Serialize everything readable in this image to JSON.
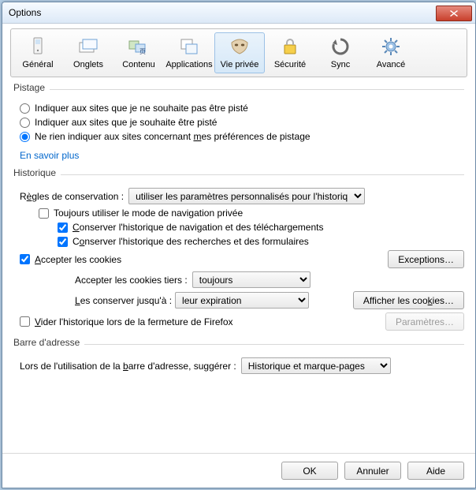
{
  "window": {
    "title": "Options"
  },
  "toolbar": {
    "items": [
      {
        "label": "Général"
      },
      {
        "label": "Onglets"
      },
      {
        "label": "Contenu"
      },
      {
        "label": "Applications"
      },
      {
        "label": "Vie privée"
      },
      {
        "label": "Sécurité"
      },
      {
        "label": "Sync"
      },
      {
        "label": "Avancé"
      }
    ],
    "selected_index": 4
  },
  "pistage": {
    "title": "Pistage",
    "r1": "Indiquer aux sites que je ne souhaite pas être pisté",
    "r2": "Indiquer aux sites que je souhaite être pisté",
    "r3_pre": "Ne rien indiquer aux sites concernant ",
    "r3_u": "m",
    "r3_post": "es préférences de pistage",
    "link": "En savoir plus"
  },
  "historique": {
    "title": "Historique",
    "rules_lbl_pre": "R",
    "rules_lbl_u": "è",
    "rules_lbl_post": "gles de conservation :",
    "rules_value": "utiliser les paramètres personnalisés pour l'historique",
    "c_private": "Toujours utiliser le mode de navigation privée",
    "c_nav_u": "C",
    "c_nav_post": "onserver l'historique de navigation et des téléchargements",
    "c_rech_pre": "C",
    "c_rech_u": "o",
    "c_rech_post": "nserver l'historique des recherches et des formulaires",
    "c_cookies_u": "A",
    "c_cookies_post": "ccepter les cookies",
    "exceptions": "Exceptions…",
    "tiers_label": "Accepter les cookies tiers :",
    "tiers_value": "toujours",
    "conserver_lbl_u": "L",
    "conserver_lbl_post": "es conserver jusqu'à :",
    "conserver_value": "leur expiration",
    "show_cookies_pre": "Afficher les coo",
    "show_cookies_u": "k",
    "show_cookies_post": "ies…",
    "c_vider_u": "V",
    "c_vider_post": "ider l'historique lors de la fermeture de Firefox",
    "parametres": "Paramètres…"
  },
  "barre": {
    "title": "Barre d'adresse",
    "lbl_pre": "Lors de l'utilisation de la ",
    "lbl_u": "b",
    "lbl_post": "arre d'adresse, suggérer :",
    "value": "Historique et marque-pages"
  },
  "footer": {
    "ok": "OK",
    "cancel": "Annuler",
    "help": "Aide"
  }
}
